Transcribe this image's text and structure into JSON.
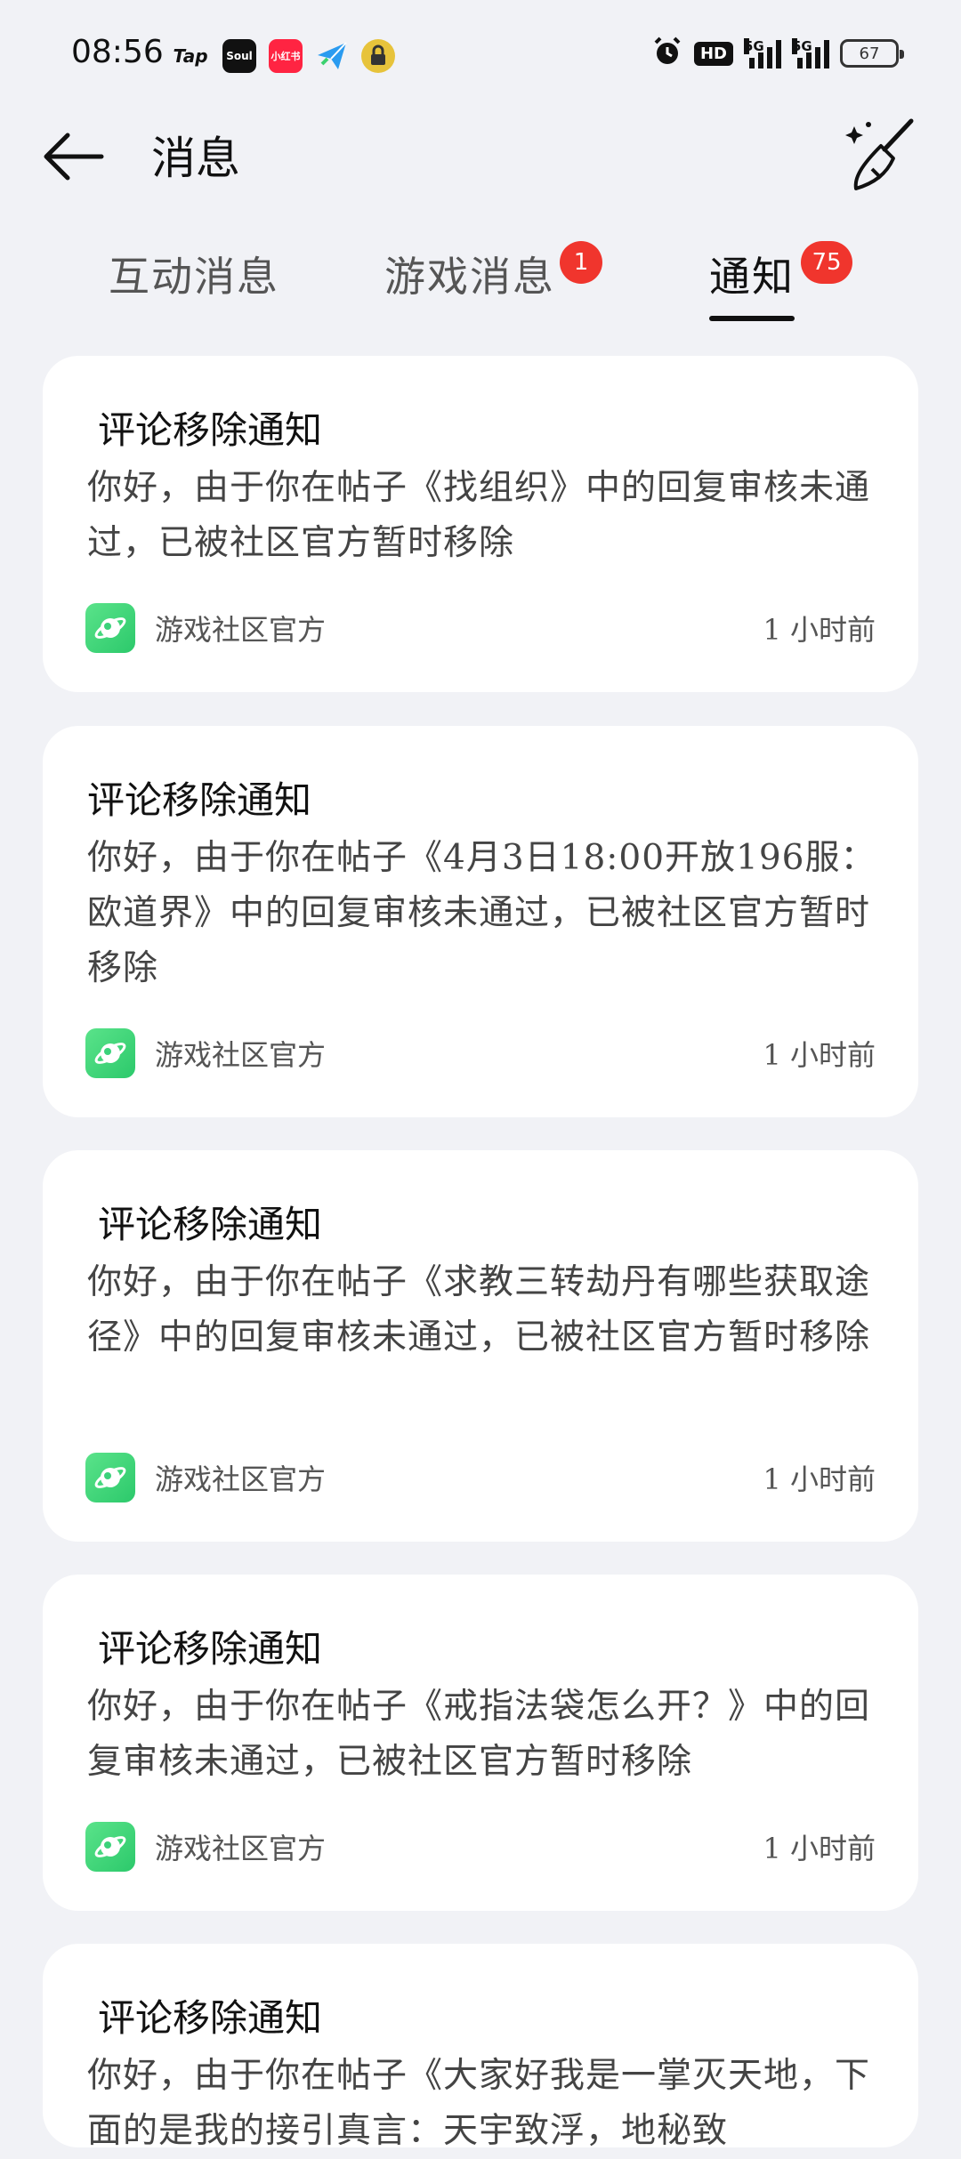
{
  "status": {
    "time": "08:56",
    "apps": [
      {
        "name": "tap-icon",
        "label": "Tap"
      },
      {
        "name": "soul-icon",
        "label": "Soul"
      },
      {
        "name": "xiaohongshu-icon",
        "label": "小红书"
      }
    ],
    "hd": "HD",
    "net1": "5G",
    "net2": "5G",
    "battery": "67"
  },
  "header": {
    "title": "消息"
  },
  "tabs": [
    {
      "label": "互动消息"
    },
    {
      "label": "游戏消息",
      "badge": "1"
    },
    {
      "label": "通知",
      "badge": "75",
      "active": true
    }
  ],
  "notifications": [
    {
      "title": "评论移除通知",
      "body": "你好，由于你在帖子《找组织》中的回复审核未通过，已被社区官方暂时移除",
      "source": "游戏社区官方",
      "time": "1 小时前"
    },
    {
      "title": "评论移除通知",
      "body": "你好，由于你在帖子《4月3日18:00开放196服：欧道界》中的回复审核未通过，已被社区官方暂时移除",
      "source": "游戏社区官方",
      "time": "1 小时前"
    },
    {
      "title": "评论移除通知",
      "body": "你好，由于你在帖子《求教三转劫丹有哪些获取途径》中的回复审核未通过，已被社区官方暂时移除",
      "source": "游戏社区官方",
      "time": "1 小时前"
    },
    {
      "title": "评论移除通知",
      "body": "你好，由于你在帖子《戒指法袋怎么开？》中的回复审核未通过，已被社区官方暂时移除",
      "source": "游戏社区官方",
      "time": "1 小时前"
    },
    {
      "title": "评论移除通知",
      "body": "你好，由于你在帖子《大家好我是一掌灭天地，下面的是我的接引真言：天宇致浮，地秘致",
      "source": "",
      "time": ""
    }
  ]
}
